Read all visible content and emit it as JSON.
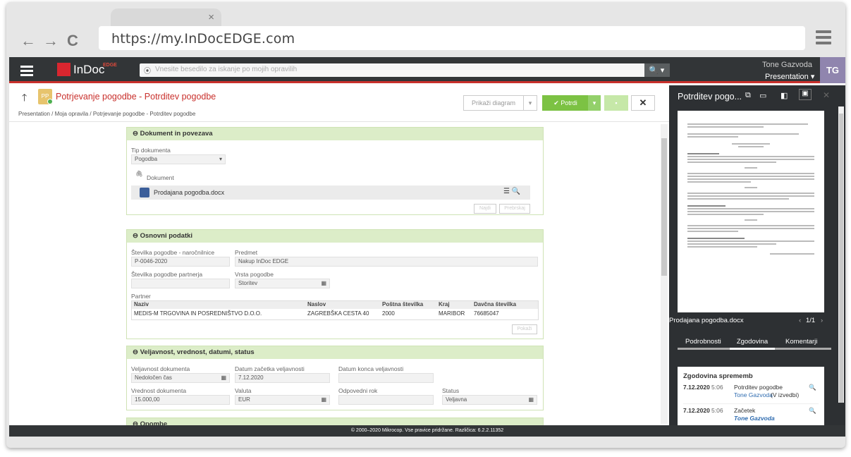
{
  "browser": {
    "url": "https://my.InDocEDGE.com",
    "tab_close": "×",
    "back": "←",
    "forward": "→",
    "reload": "C"
  },
  "topbar": {
    "logo": "InDoc",
    "logo_sup": "EDGE",
    "search_placeholder": "Vnesite besedilo za iskanje po mojih opravilih",
    "user_name": "Tone Gazvoda",
    "environment": "Presentation ▾",
    "avatar": "TG"
  },
  "header": {
    "icon_text": "PP",
    "title": "Potrjevanje pogodbe - Potrditev pogodbe",
    "breadcrumb": "Presentation  /  Moja opravila  /  Potrjevanje pogodbe - Potrditev pogodbe",
    "show_diagram": "Prikaži diagram",
    "confirm": "Potrdi"
  },
  "doc_panel": {
    "title": "Dokument in povezava",
    "type_label": "Tip dokumenta",
    "type_value": "Pogodba",
    "doc_label": "Dokument",
    "doc_name": "Prodajana pogodba.docx",
    "find_btn": "Najdi",
    "upload_btn": "Prebrskaj"
  },
  "basic_panel": {
    "title": "Osnovni podatki",
    "contract_no_label": "Številka pogodbe - naročnilnice",
    "contract_no": "P-0046-2020",
    "subject_label": "Predmet",
    "subject": "Nakup InDoc EDGE",
    "partner_no_label": "Številka pogodbe partnerja",
    "partner_no": "",
    "type_label": "Vrsta pogodbe",
    "type_value": "Storitev",
    "partner_label": "Partner",
    "table_headers": [
      "Naziv",
      "Naslov",
      "Poštna številka",
      "Kraj",
      "Davčna številka"
    ],
    "table_row": [
      "MEDIS-M TRGOVINA IN POSREDNIŠTVO D.O.O.",
      "ZAGREBŠKA CESTA 40",
      "2000",
      "MARIBOR",
      "76685047"
    ],
    "show_btn": "Pokaži"
  },
  "validity_panel": {
    "title": "Veljavnost, vrednost, datumi, status",
    "validity_label": "Veljavnost dokumenta",
    "validity": "Nedoločen čas",
    "start_label": "Datum začetka veljavnosti",
    "start": "7.12.2020",
    "end_label": "Datum konca veljavnosti",
    "end": "",
    "value_label": "Vrednost dokumenta",
    "value": "15.000,00",
    "currency_label": "Valuta",
    "currency": "EUR",
    "deadline_label": "Odpovedni rok",
    "deadline": "",
    "status_label": "Status",
    "status": "Veljavna"
  },
  "notes_panel": {
    "title": "Opombe"
  },
  "sidebar": {
    "title": "Potrditev pogo...",
    "doc_name": "Prodajana pogodba.docx",
    "pages": "1/1",
    "tabs": [
      "Podrobnosti",
      "Zgodovina",
      "Komentarji"
    ],
    "history_title": "Zgodovina sprememb",
    "history": [
      {
        "date": "7.12.2020",
        "time": "5:06",
        "action": "Potrditev pogodbe",
        "user": "Tone Gazvoda",
        "extra": " (V izvedbi)"
      },
      {
        "date": "7.12.2020",
        "time": "5:06",
        "action": "Začetek",
        "user": "Tone Gazvoda",
        "extra": ""
      }
    ]
  },
  "footer": {
    "text": "© 2000–2020 Mikrocop. Vse pravice pridržane.  Različica:  6.2.2.11352"
  }
}
